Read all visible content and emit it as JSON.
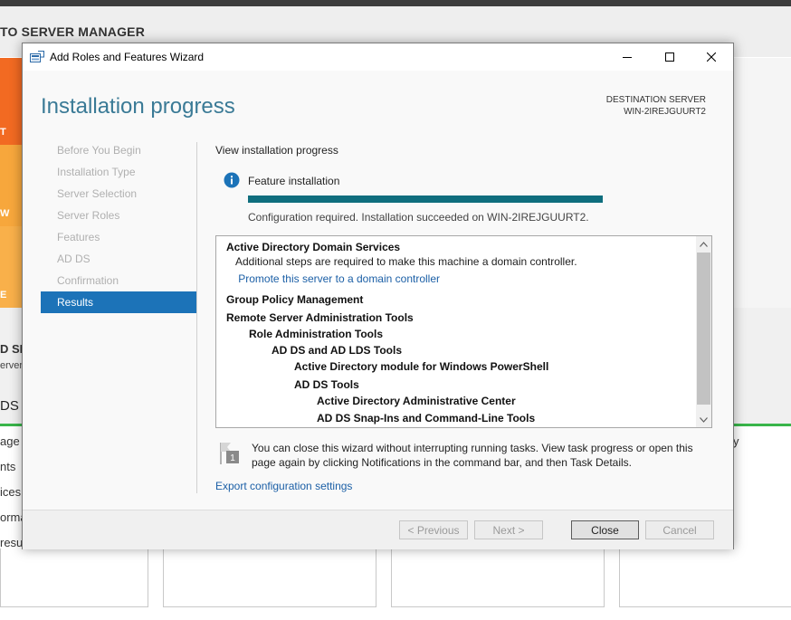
{
  "background": {
    "title": "TO SERVER MANAGER",
    "tile_letters": [
      "T",
      "W",
      "E"
    ],
    "mid_label": "D SE",
    "mid_sub": "erver",
    "ads_label": "DS",
    "list_fragments": [
      "age",
      "nts",
      "ices",
      "orma",
      "resu"
    ],
    "right_fragment": "y"
  },
  "window": {
    "title": "Add Roles and Features Wizard",
    "controls": {
      "minimize": "—",
      "maximize": "☐",
      "close": "✕"
    }
  },
  "page": {
    "heading": "Installation progress",
    "destination_label": "DESTINATION SERVER",
    "destination_server": "WIN-2IREJGUURT2"
  },
  "nav": {
    "items": [
      {
        "label": "Before You Begin",
        "active": false
      },
      {
        "label": "Installation Type",
        "active": false
      },
      {
        "label": "Server Selection",
        "active": false
      },
      {
        "label": "Server Roles",
        "active": false
      },
      {
        "label": "Features",
        "active": false
      },
      {
        "label": "AD DS",
        "active": false
      },
      {
        "label": "Confirmation",
        "active": false
      },
      {
        "label": "Results",
        "active": true
      }
    ]
  },
  "progress": {
    "view_label": "View installation progress",
    "feature_label": "Feature installation",
    "fraction": 1.0,
    "status": "Configuration required. Installation succeeded on WIN-2IREJGUURT2."
  },
  "results": [
    {
      "text": "Active Directory Domain Services",
      "level": 0,
      "style": "bold"
    },
    {
      "text": "Additional steps are required to make this machine a domain controller.",
      "level": 0.4,
      "style": "normal"
    },
    {
      "text": "Promote this server to a domain controller",
      "level": 0.53,
      "style": "link"
    },
    {
      "text": "Group Policy Management",
      "level": 0,
      "style": "bold"
    },
    {
      "text": "Remote Server Administration Tools",
      "level": 0,
      "style": "bold"
    },
    {
      "text": "Role Administration Tools",
      "level": 1,
      "style": "bold"
    },
    {
      "text": "AD DS and AD LDS Tools",
      "level": 2,
      "style": "bold"
    },
    {
      "text": "Active Directory module for Windows PowerShell",
      "level": 3,
      "style": "bold"
    },
    {
      "text": "AD DS Tools",
      "level": 3,
      "style": "bold"
    },
    {
      "text": "Active Directory Administrative Center",
      "level": 4,
      "style": "bold"
    },
    {
      "text": "AD DS Snap-Ins and Command-Line Tools",
      "level": 4,
      "style": "bold"
    }
  ],
  "notice": {
    "flag_badge": "1",
    "text": "You can close this wizard without interrupting running tasks. View task progress or open this page again by clicking Notifications in the command bar, and then Task Details."
  },
  "export_link": "Export configuration settings",
  "buttons": {
    "previous": "< Previous",
    "next": "Next >",
    "close": "Close",
    "cancel": "Cancel"
  },
  "colors": {
    "accent": "#1c73b8",
    "heading": "#3a7a96",
    "progress": "#0f6e7e",
    "link": "#1b5fa6"
  }
}
